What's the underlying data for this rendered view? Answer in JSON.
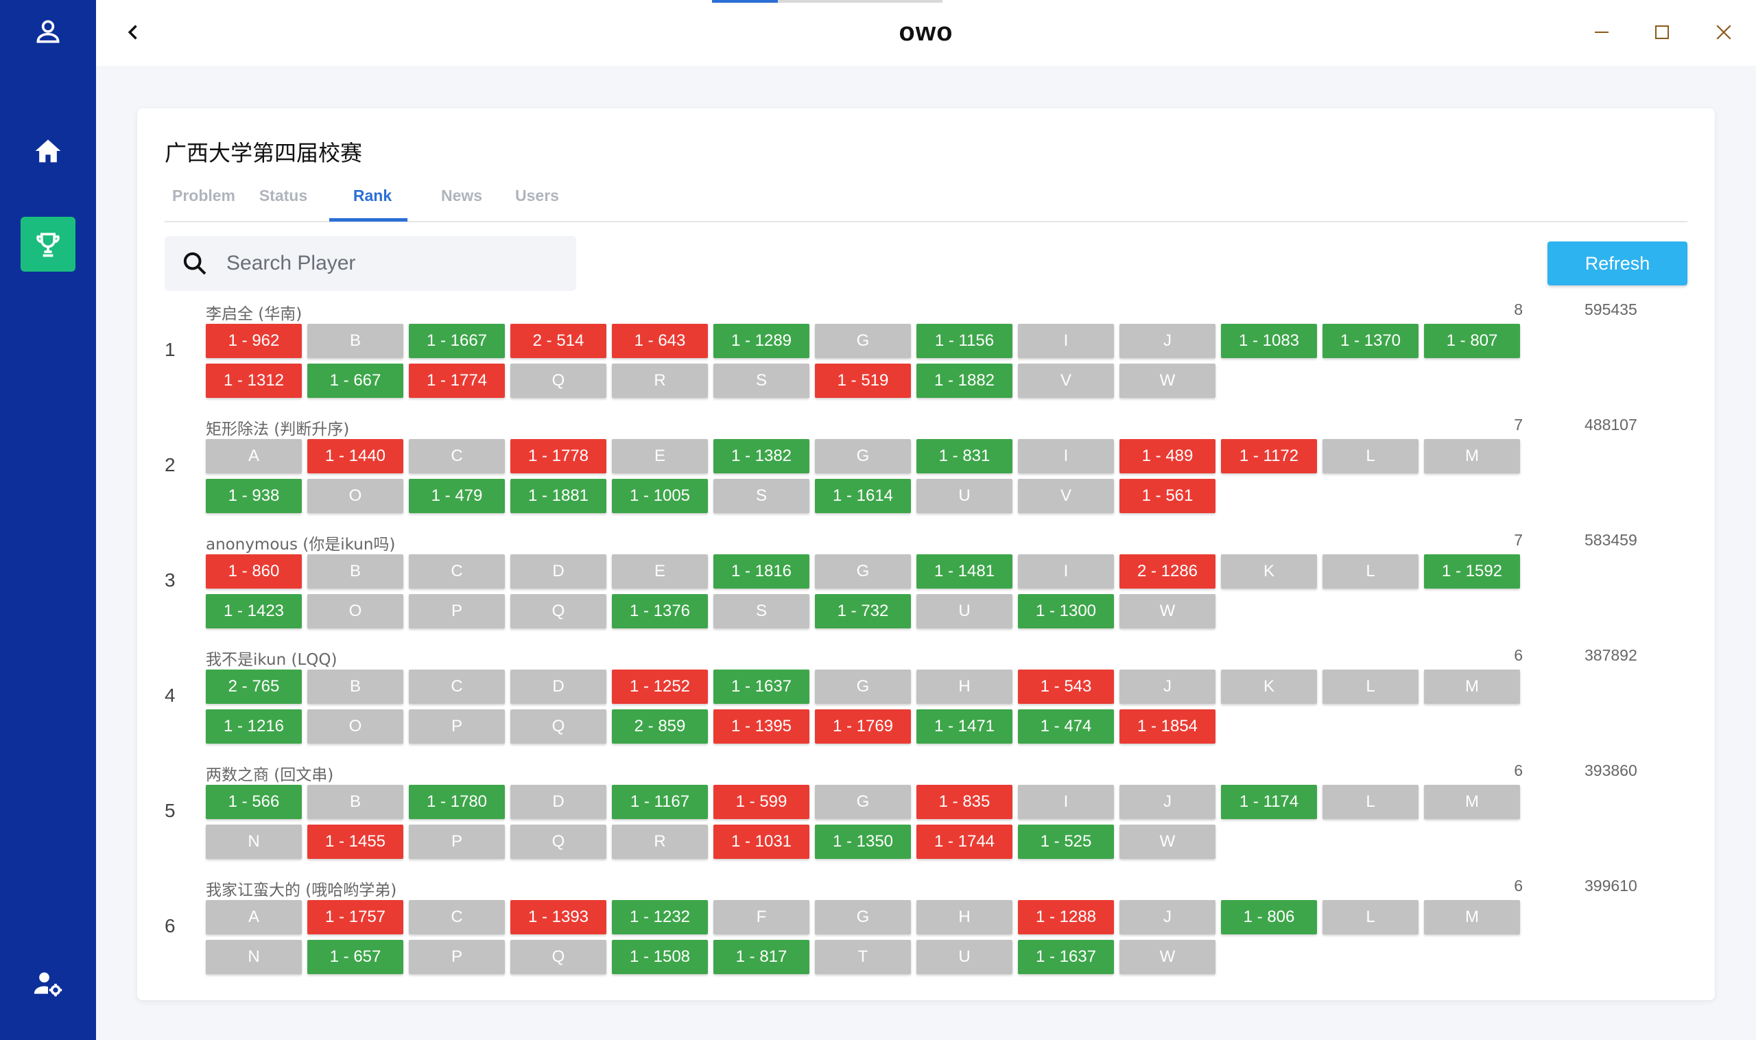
{
  "window": {
    "title": "owo",
    "colors": {
      "sidebar": "#0d2f9a",
      "active_nav": "#1bbd7e",
      "accent": "#2b6fd6"
    }
  },
  "sidebar": {
    "items": [
      {
        "name": "user-icon"
      },
      {
        "name": "home-icon"
      },
      {
        "name": "trophy-icon",
        "active": true
      },
      {
        "name": "user-settings-icon"
      }
    ]
  },
  "contest": {
    "title": "广西大学第四届校赛"
  },
  "tabs": [
    {
      "label": "Problem",
      "active": false
    },
    {
      "label": "Status",
      "active": false
    },
    {
      "label": "Rank",
      "active": true
    },
    {
      "label": "News",
      "active": false
    },
    {
      "label": "Users",
      "active": false
    }
  ],
  "search": {
    "placeholder": "Search Player",
    "value": ""
  },
  "refresh_label": "Refresh",
  "ranks": [
    {
      "rank": "1",
      "name": "李启全 (华南)",
      "solved": "8",
      "penalty": "595435",
      "cells": [
        {
          "t": "1 - 962",
          "s": "wa"
        },
        {
          "t": "B",
          "s": "none"
        },
        {
          "t": "1 - 1667",
          "s": "ac"
        },
        {
          "t": "2 - 514",
          "s": "wa"
        },
        {
          "t": "1 - 643",
          "s": "wa"
        },
        {
          "t": "1 - 1289",
          "s": "ac"
        },
        {
          "t": "G",
          "s": "none"
        },
        {
          "t": "1 - 1156",
          "s": "ac"
        },
        {
          "t": "I",
          "s": "none"
        },
        {
          "t": "J",
          "s": "none"
        },
        {
          "t": "1 - 1083",
          "s": "ac"
        },
        {
          "t": "1 - 1370",
          "s": "ac"
        },
        {
          "t": "1 - 807",
          "s": "ac"
        },
        {
          "t": "1 - 1312",
          "s": "wa"
        },
        {
          "t": "1 - 667",
          "s": "ac"
        },
        {
          "t": "1 - 1774",
          "s": "wa"
        },
        {
          "t": "Q",
          "s": "none"
        },
        {
          "t": "R",
          "s": "none"
        },
        {
          "t": "S",
          "s": "none"
        },
        {
          "t": "1 - 519",
          "s": "wa"
        },
        {
          "t": "1 - 1882",
          "s": "ac"
        },
        {
          "t": "V",
          "s": "none"
        },
        {
          "t": "W",
          "s": "none"
        }
      ]
    },
    {
      "rank": "2",
      "name": "矩形除法 (判断升序)",
      "solved": "7",
      "penalty": "488107",
      "cells": [
        {
          "t": "A",
          "s": "none"
        },
        {
          "t": "1 - 1440",
          "s": "wa"
        },
        {
          "t": "C",
          "s": "none"
        },
        {
          "t": "1 - 1778",
          "s": "wa"
        },
        {
          "t": "E",
          "s": "none"
        },
        {
          "t": "1 - 1382",
          "s": "ac"
        },
        {
          "t": "G",
          "s": "none"
        },
        {
          "t": "1 - 831",
          "s": "ac"
        },
        {
          "t": "I",
          "s": "none"
        },
        {
          "t": "1 - 489",
          "s": "wa"
        },
        {
          "t": "1 - 1172",
          "s": "wa"
        },
        {
          "t": "L",
          "s": "none"
        },
        {
          "t": "M",
          "s": "none"
        },
        {
          "t": "1 - 938",
          "s": "ac"
        },
        {
          "t": "O",
          "s": "none"
        },
        {
          "t": "1 - 479",
          "s": "ac"
        },
        {
          "t": "1 - 1881",
          "s": "ac"
        },
        {
          "t": "1 - 1005",
          "s": "ac"
        },
        {
          "t": "S",
          "s": "none"
        },
        {
          "t": "1 - 1614",
          "s": "ac"
        },
        {
          "t": "U",
          "s": "none"
        },
        {
          "t": "V",
          "s": "none"
        },
        {
          "t": "1 - 561",
          "s": "wa"
        }
      ]
    },
    {
      "rank": "3",
      "name": "anonymous (你是ikun吗)",
      "solved": "7",
      "penalty": "583459",
      "cells": [
        {
          "t": "1 - 860",
          "s": "wa"
        },
        {
          "t": "B",
          "s": "none"
        },
        {
          "t": "C",
          "s": "none"
        },
        {
          "t": "D",
          "s": "none"
        },
        {
          "t": "E",
          "s": "none"
        },
        {
          "t": "1 - 1816",
          "s": "ac"
        },
        {
          "t": "G",
          "s": "none"
        },
        {
          "t": "1 - 1481",
          "s": "ac"
        },
        {
          "t": "I",
          "s": "none"
        },
        {
          "t": "2 - 1286",
          "s": "wa"
        },
        {
          "t": "K",
          "s": "none"
        },
        {
          "t": "L",
          "s": "none"
        },
        {
          "t": "1 - 1592",
          "s": "ac"
        },
        {
          "t": "1 - 1423",
          "s": "ac"
        },
        {
          "t": "O",
          "s": "none"
        },
        {
          "t": "P",
          "s": "none"
        },
        {
          "t": "Q",
          "s": "none"
        },
        {
          "t": "1 - 1376",
          "s": "ac"
        },
        {
          "t": "S",
          "s": "none"
        },
        {
          "t": "1 - 732",
          "s": "ac"
        },
        {
          "t": "U",
          "s": "none"
        },
        {
          "t": "1 - 1300",
          "s": "ac"
        },
        {
          "t": "W",
          "s": "none"
        }
      ]
    },
    {
      "rank": "4",
      "name": "我不是ikun (LQQ)",
      "solved": "6",
      "penalty": "387892",
      "cells": [
        {
          "t": "2 - 765",
          "s": "ac"
        },
        {
          "t": "B",
          "s": "none"
        },
        {
          "t": "C",
          "s": "none"
        },
        {
          "t": "D",
          "s": "none"
        },
        {
          "t": "1 - 1252",
          "s": "wa"
        },
        {
          "t": "1 - 1637",
          "s": "ac"
        },
        {
          "t": "G",
          "s": "none"
        },
        {
          "t": "H",
          "s": "none"
        },
        {
          "t": "1 - 543",
          "s": "wa"
        },
        {
          "t": "J",
          "s": "none"
        },
        {
          "t": "K",
          "s": "none"
        },
        {
          "t": "L",
          "s": "none"
        },
        {
          "t": "M",
          "s": "none"
        },
        {
          "t": "1 - 1216",
          "s": "ac"
        },
        {
          "t": "O",
          "s": "none"
        },
        {
          "t": "P",
          "s": "none"
        },
        {
          "t": "Q",
          "s": "none"
        },
        {
          "t": "2 - 859",
          "s": "ac"
        },
        {
          "t": "1 - 1395",
          "s": "wa"
        },
        {
          "t": "1 - 1769",
          "s": "wa"
        },
        {
          "t": "1 - 1471",
          "s": "ac"
        },
        {
          "t": "1 - 474",
          "s": "ac"
        },
        {
          "t": "1 - 1854",
          "s": "wa"
        }
      ]
    },
    {
      "rank": "5",
      "name": "两数之商 (回文串)",
      "solved": "6",
      "penalty": "393860",
      "cells": [
        {
          "t": "1 - 566",
          "s": "ac"
        },
        {
          "t": "B",
          "s": "none"
        },
        {
          "t": "1 - 1780",
          "s": "ac"
        },
        {
          "t": "D",
          "s": "none"
        },
        {
          "t": "1 - 1167",
          "s": "ac"
        },
        {
          "t": "1 - 599",
          "s": "wa"
        },
        {
          "t": "G",
          "s": "none"
        },
        {
          "t": "1 - 835",
          "s": "wa"
        },
        {
          "t": "I",
          "s": "none"
        },
        {
          "t": "J",
          "s": "none"
        },
        {
          "t": "1 - 1174",
          "s": "ac"
        },
        {
          "t": "L",
          "s": "none"
        },
        {
          "t": "M",
          "s": "none"
        },
        {
          "t": "N",
          "s": "none"
        },
        {
          "t": "1 - 1455",
          "s": "wa"
        },
        {
          "t": "P",
          "s": "none"
        },
        {
          "t": "Q",
          "s": "none"
        },
        {
          "t": "R",
          "s": "none"
        },
        {
          "t": "1 - 1031",
          "s": "wa"
        },
        {
          "t": "1 - 1350",
          "s": "ac"
        },
        {
          "t": "1 - 1744",
          "s": "wa"
        },
        {
          "t": "1 - 525",
          "s": "ac"
        },
        {
          "t": "W",
          "s": "none"
        }
      ]
    },
    {
      "rank": "6",
      "name": "我家讧蛮大的 (哦哈哟学弟)",
      "solved": "6",
      "penalty": "399610",
      "cells": [
        {
          "t": "A",
          "s": "none"
        },
        {
          "t": "1 - 1757",
          "s": "wa"
        },
        {
          "t": "C",
          "s": "none"
        },
        {
          "t": "1 - 1393",
          "s": "wa"
        },
        {
          "t": "1 - 1232",
          "s": "ac"
        },
        {
          "t": "F",
          "s": "none"
        },
        {
          "t": "G",
          "s": "none"
        },
        {
          "t": "H",
          "s": "none"
        },
        {
          "t": "1 - 1288",
          "s": "wa"
        },
        {
          "t": "J",
          "s": "none"
        },
        {
          "t": "1 - 806",
          "s": "ac"
        },
        {
          "t": "L",
          "s": "none"
        },
        {
          "t": "M",
          "s": "none"
        },
        {
          "t": "N",
          "s": "none"
        },
        {
          "t": "1 - 657",
          "s": "ac"
        },
        {
          "t": "P",
          "s": "none"
        },
        {
          "t": "Q",
          "s": "none"
        },
        {
          "t": "1 - 1508",
          "s": "ac"
        },
        {
          "t": "1 - 817",
          "s": "ac"
        },
        {
          "t": "T",
          "s": "none"
        },
        {
          "t": "U",
          "s": "none"
        },
        {
          "t": "1 - 1637",
          "s": "ac"
        },
        {
          "t": "W",
          "s": "none"
        }
      ]
    }
  ]
}
